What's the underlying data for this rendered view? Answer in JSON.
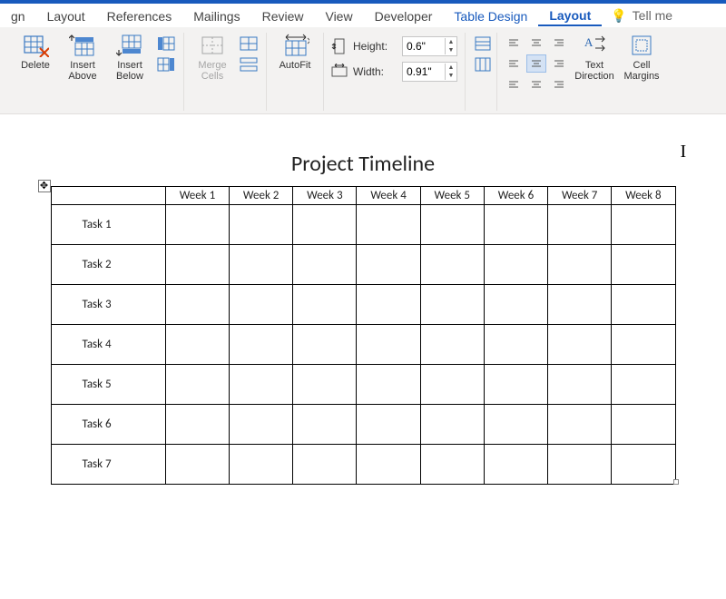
{
  "tabs": [
    "gn",
    "Layout",
    "References",
    "Mailings",
    "Review",
    "View",
    "Developer",
    "Table Design",
    "Layout"
  ],
  "active_tab_index": 8,
  "contextual_tab_indices": [
    7,
    8
  ],
  "tell_me": "Tell me",
  "ribbon": {
    "delete": "Delete",
    "insert_above": "Insert\nAbove",
    "insert_below": "Insert\nBelow",
    "merge_cells": "Merge\nCells",
    "autofit": "AutoFit",
    "height_label": "Height:",
    "width_label": "Width:",
    "height_value": "0.6\"",
    "width_value": "0.91\"",
    "text_direction": "Text\nDirection",
    "cell_margins": "Cell\nMargins"
  },
  "document": {
    "title": "Project Timeline",
    "columns": [
      "",
      "Week 1",
      "Week 2",
      "Week 3",
      "Week 4",
      "Week 5",
      "Week 6",
      "Week 7",
      "Week 8"
    ],
    "rows": [
      "Task 1",
      "Task 2",
      "Task 3",
      "Task 4",
      "Task 5",
      "Task 6",
      "Task 7"
    ]
  },
  "icons": {
    "bulb": "💡"
  }
}
